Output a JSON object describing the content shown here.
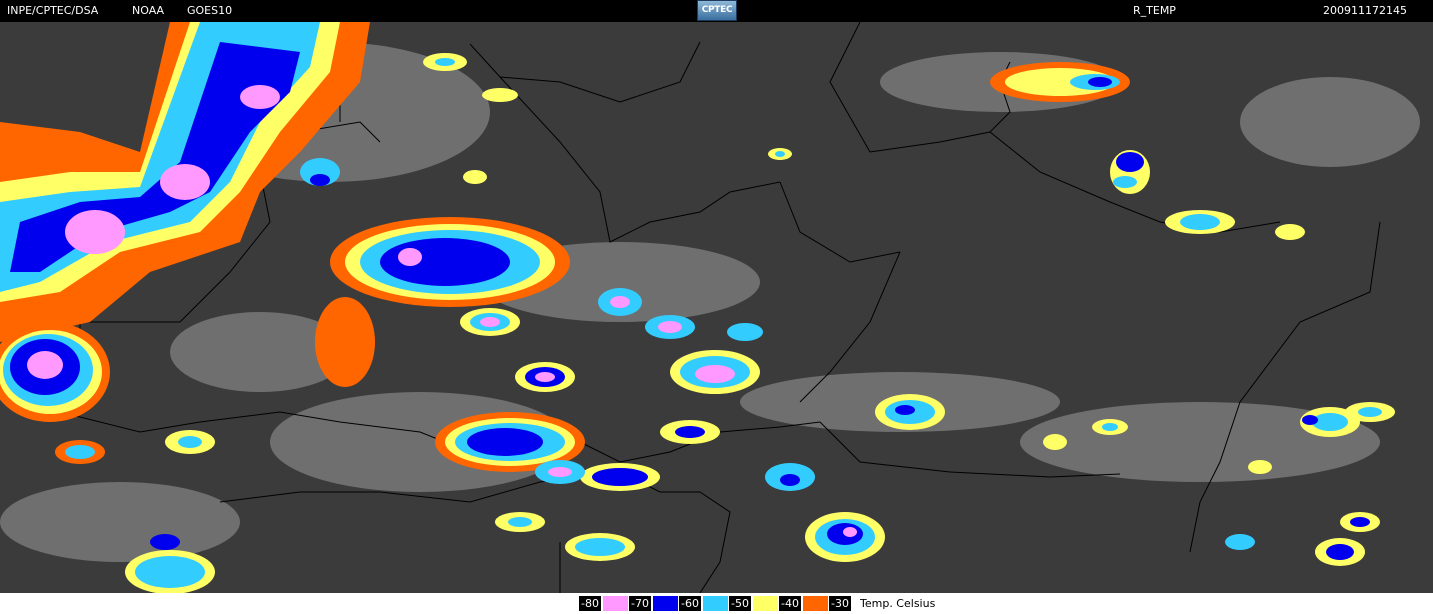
{
  "header": {
    "agency": "INPE/CPTEC/DSA",
    "source": "NOAA",
    "satellite": "GOES10",
    "logo_text": "CPTEC",
    "product": "R_TEMP",
    "timestamp": "200911172145"
  },
  "legend": {
    "unit_label": "Temp. Celsius",
    "classes": [
      {
        "label": "-80",
        "color": "#ff99ff"
      },
      {
        "label": "-70",
        "color": "#0000ee"
      },
      {
        "label": "-60",
        "color": "#33ccff"
      },
      {
        "label": "-50",
        "color": "#ffff66"
      },
      {
        "label": "-40",
        "color": "#ff6600"
      },
      {
        "label": "-30",
        "color": "#ff6600"
      }
    ]
  },
  "colors": {
    "background_gray": "#3b3b3b",
    "cloud_gray": "#a8a8a8",
    "border_line": "#000000"
  }
}
